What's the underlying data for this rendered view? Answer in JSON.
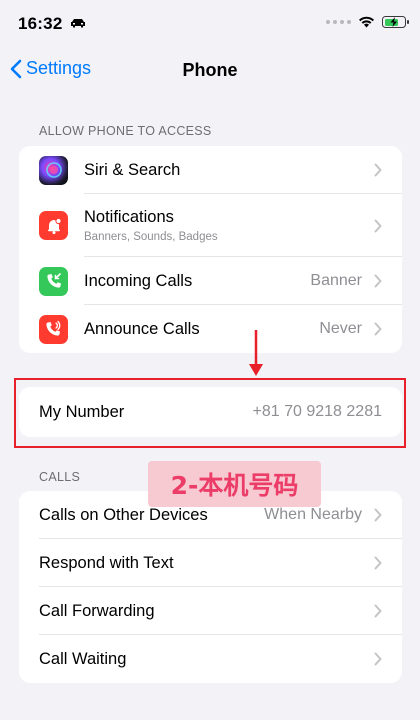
{
  "status_bar": {
    "time": "16:32"
  },
  "nav": {
    "back_label": "Settings",
    "title": "Phone"
  },
  "sections": {
    "access": {
      "header": "ALLOW PHONE TO ACCESS",
      "items": [
        {
          "label": "Siri & Search",
          "icon": "siri-icon"
        },
        {
          "label": "Notifications",
          "sublabel": "Banners, Sounds, Badges",
          "icon": "notifications-icon"
        },
        {
          "label": "Incoming Calls",
          "value": "Banner",
          "icon": "incoming-calls-icon"
        },
        {
          "label": "Announce Calls",
          "value": "Never",
          "icon": "announce-calls-icon"
        }
      ]
    },
    "my_number": {
      "label": "My Number",
      "value": "+81 70 9218 2281"
    },
    "calls": {
      "header": "CALLS",
      "items": [
        {
          "label": "Calls on Other Devices",
          "value": "When Nearby"
        },
        {
          "label": "Respond with Text"
        },
        {
          "label": "Call Forwarding"
        },
        {
          "label": "Call Waiting"
        }
      ]
    }
  },
  "annotation": {
    "tag": "2-本机号码",
    "color": "#e8202a"
  },
  "colors": {
    "accent": "#007aff",
    "background": "#f2f2f7"
  }
}
